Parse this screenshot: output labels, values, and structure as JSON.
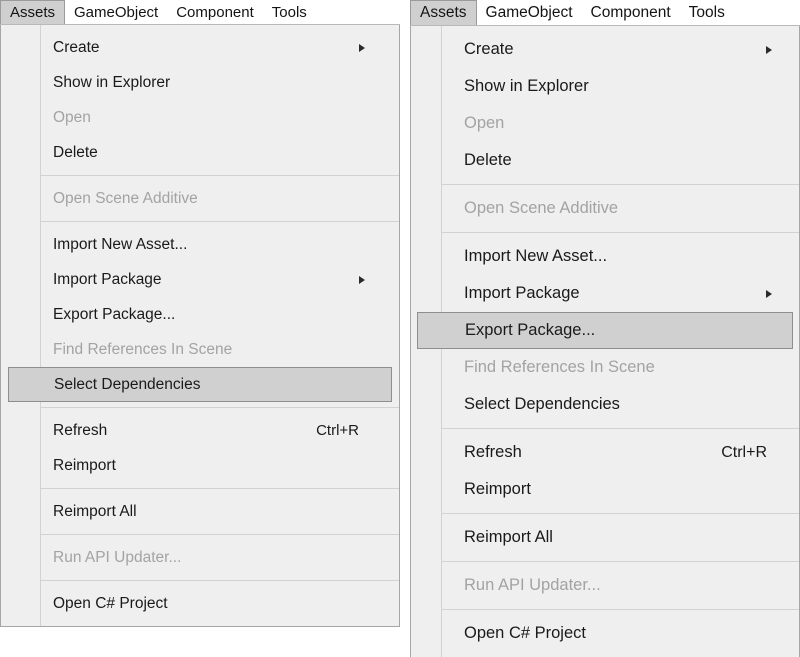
{
  "menubar": {
    "items": [
      {
        "label": "Assets",
        "active": true
      },
      {
        "label": "GameObject",
        "active": false
      },
      {
        "label": "Component",
        "active": false
      },
      {
        "label": "Tools",
        "active": false
      }
    ]
  },
  "colors": {
    "panel_background": "#efefef",
    "panel_border": "#a6a6a6",
    "separator": "#d2d2d2",
    "text": "#1a1a1a",
    "text_disabled": "#a3a3a3",
    "highlight_fill": "#d0d0d0",
    "highlight_border": "#8e8e8e",
    "menubar_active_fill": "#cfcfcf"
  },
  "left_menu": {
    "title": "Assets",
    "highlighted_item": "Select Dependencies",
    "groups": [
      {
        "items": [
          {
            "label": "Create",
            "disabled": false,
            "submenu": true,
            "shortcut": "",
            "highlighted": false
          },
          {
            "label": "Show in Explorer",
            "disabled": false,
            "submenu": false,
            "shortcut": "",
            "highlighted": false
          },
          {
            "label": "Open",
            "disabled": true,
            "submenu": false,
            "shortcut": "",
            "highlighted": false
          },
          {
            "label": "Delete",
            "disabled": false,
            "submenu": false,
            "shortcut": "",
            "highlighted": false
          }
        ]
      },
      {
        "items": [
          {
            "label": "Open Scene Additive",
            "disabled": true,
            "submenu": false,
            "shortcut": "",
            "highlighted": false
          }
        ]
      },
      {
        "items": [
          {
            "label": "Import New Asset...",
            "disabled": false,
            "submenu": false,
            "shortcut": "",
            "highlighted": false
          },
          {
            "label": "Import Package",
            "disabled": false,
            "submenu": true,
            "shortcut": "",
            "highlighted": false
          },
          {
            "label": "Export Package...",
            "disabled": false,
            "submenu": false,
            "shortcut": "",
            "highlighted": false
          },
          {
            "label": "Find References In Scene",
            "disabled": true,
            "submenu": false,
            "shortcut": "",
            "highlighted": false
          },
          {
            "label": "Select Dependencies",
            "disabled": false,
            "submenu": false,
            "shortcut": "",
            "highlighted": true
          }
        ]
      },
      {
        "items": [
          {
            "label": "Refresh",
            "disabled": false,
            "submenu": false,
            "shortcut": "Ctrl+R",
            "highlighted": false
          },
          {
            "label": "Reimport",
            "disabled": false,
            "submenu": false,
            "shortcut": "",
            "highlighted": false
          }
        ]
      },
      {
        "items": [
          {
            "label": "Reimport All",
            "disabled": false,
            "submenu": false,
            "shortcut": "",
            "highlighted": false
          }
        ]
      },
      {
        "items": [
          {
            "label": "Run API Updater...",
            "disabled": true,
            "submenu": false,
            "shortcut": "",
            "highlighted": false
          }
        ]
      },
      {
        "items": [
          {
            "label": "Open C# Project",
            "disabled": false,
            "submenu": false,
            "shortcut": "",
            "highlighted": false
          }
        ]
      }
    ]
  },
  "right_menu": {
    "title": "Assets",
    "highlighted_item": "Export Package...",
    "groups": [
      {
        "items": [
          {
            "label": "Create",
            "disabled": false,
            "submenu": true,
            "shortcut": "",
            "highlighted": false
          },
          {
            "label": "Show in Explorer",
            "disabled": false,
            "submenu": false,
            "shortcut": "",
            "highlighted": false
          },
          {
            "label": "Open",
            "disabled": true,
            "submenu": false,
            "shortcut": "",
            "highlighted": false
          },
          {
            "label": "Delete",
            "disabled": false,
            "submenu": false,
            "shortcut": "",
            "highlighted": false
          }
        ]
      },
      {
        "items": [
          {
            "label": "Open Scene Additive",
            "disabled": true,
            "submenu": false,
            "shortcut": "",
            "highlighted": false
          }
        ]
      },
      {
        "items": [
          {
            "label": "Import New Asset...",
            "disabled": false,
            "submenu": false,
            "shortcut": "",
            "highlighted": false
          },
          {
            "label": "Import Package",
            "disabled": false,
            "submenu": true,
            "shortcut": "",
            "highlighted": false
          },
          {
            "label": "Export Package...",
            "disabled": false,
            "submenu": false,
            "shortcut": "",
            "highlighted": true
          },
          {
            "label": "Find References In Scene",
            "disabled": true,
            "submenu": false,
            "shortcut": "",
            "highlighted": false
          },
          {
            "label": "Select Dependencies",
            "disabled": false,
            "submenu": false,
            "shortcut": "",
            "highlighted": false
          }
        ]
      },
      {
        "items": [
          {
            "label": "Refresh",
            "disabled": false,
            "submenu": false,
            "shortcut": "Ctrl+R",
            "highlighted": false
          },
          {
            "label": "Reimport",
            "disabled": false,
            "submenu": false,
            "shortcut": "",
            "highlighted": false
          }
        ]
      },
      {
        "items": [
          {
            "label": "Reimport All",
            "disabled": false,
            "submenu": false,
            "shortcut": "",
            "highlighted": false
          }
        ]
      },
      {
        "items": [
          {
            "label": "Run API Updater...",
            "disabled": true,
            "submenu": false,
            "shortcut": "",
            "highlighted": false
          }
        ]
      },
      {
        "items": [
          {
            "label": "Open C# Project",
            "disabled": false,
            "submenu": false,
            "shortcut": "",
            "highlighted": false
          }
        ]
      }
    ]
  }
}
